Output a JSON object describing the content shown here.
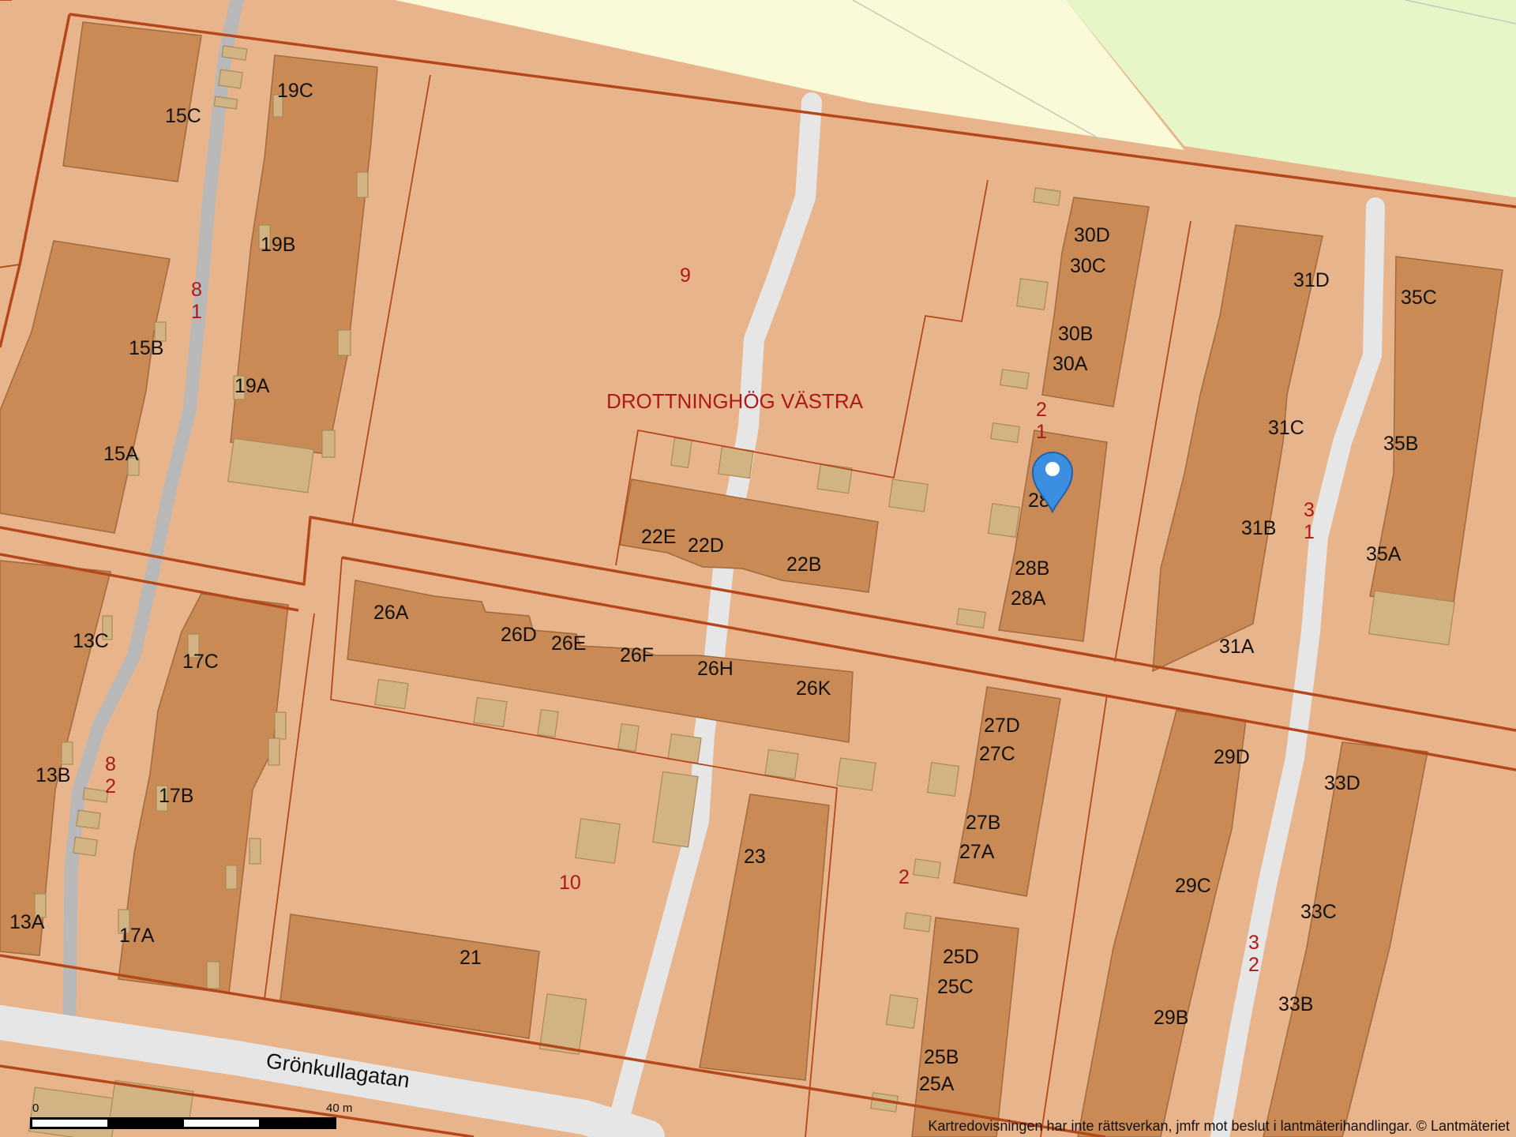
{
  "map": {
    "colors": {
      "parcel": "#e8b48c",
      "building": "#c98a55",
      "building_stroke": "#a06a3c",
      "outbuilding": "#d2b484",
      "path": "#e6e6e6",
      "footpath": "#b8b8b8",
      "boundary": "#b4481a",
      "park": "#e6f6c6",
      "open_land": "#fafad8",
      "marker": "#3c8ee0"
    },
    "area_name": "DROTTNINGHÖG VÄSTRA",
    "street_name": "Grönkullagatan",
    "property_numbers": [
      "9",
      "10",
      "2"
    ],
    "property_stacks": [
      {
        "top": "8",
        "bottom": "1"
      },
      {
        "top": "8",
        "bottom": "2"
      },
      {
        "top": "2",
        "bottom": "1"
      },
      {
        "top": "3",
        "bottom": "1"
      },
      {
        "top": "3",
        "bottom": "2"
      }
    ],
    "address_labels": [
      "15C",
      "15B",
      "15A",
      "19C",
      "19B",
      "19A",
      "13C",
      "13B",
      "13A",
      "17C",
      "17B",
      "17A",
      "30D",
      "30C",
      "30B",
      "30A",
      "28B",
      "28A",
      "22E",
      "22D",
      "22B",
      "26A",
      "26D",
      "26E",
      "26F",
      "26H",
      "26K",
      "31D",
      "31C",
      "31B",
      "31A",
      "35C",
      "35B",
      "35A",
      "27D",
      "27C",
      "27B",
      "27A",
      "25D",
      "25C",
      "25B",
      "25A",
      "29D",
      "29C",
      "29B",
      "33D",
      "33C",
      "33B",
      "21",
      "23"
    ],
    "marker_label": "28",
    "marker_icon": "map-pin-icon",
    "scale": {
      "start": "0",
      "end": "40 m"
    },
    "attribution": "Kartredovisningen har inte rättsverkan, jmfr mot beslut i lantmäterihandlingar. © Lantmäteriet"
  }
}
